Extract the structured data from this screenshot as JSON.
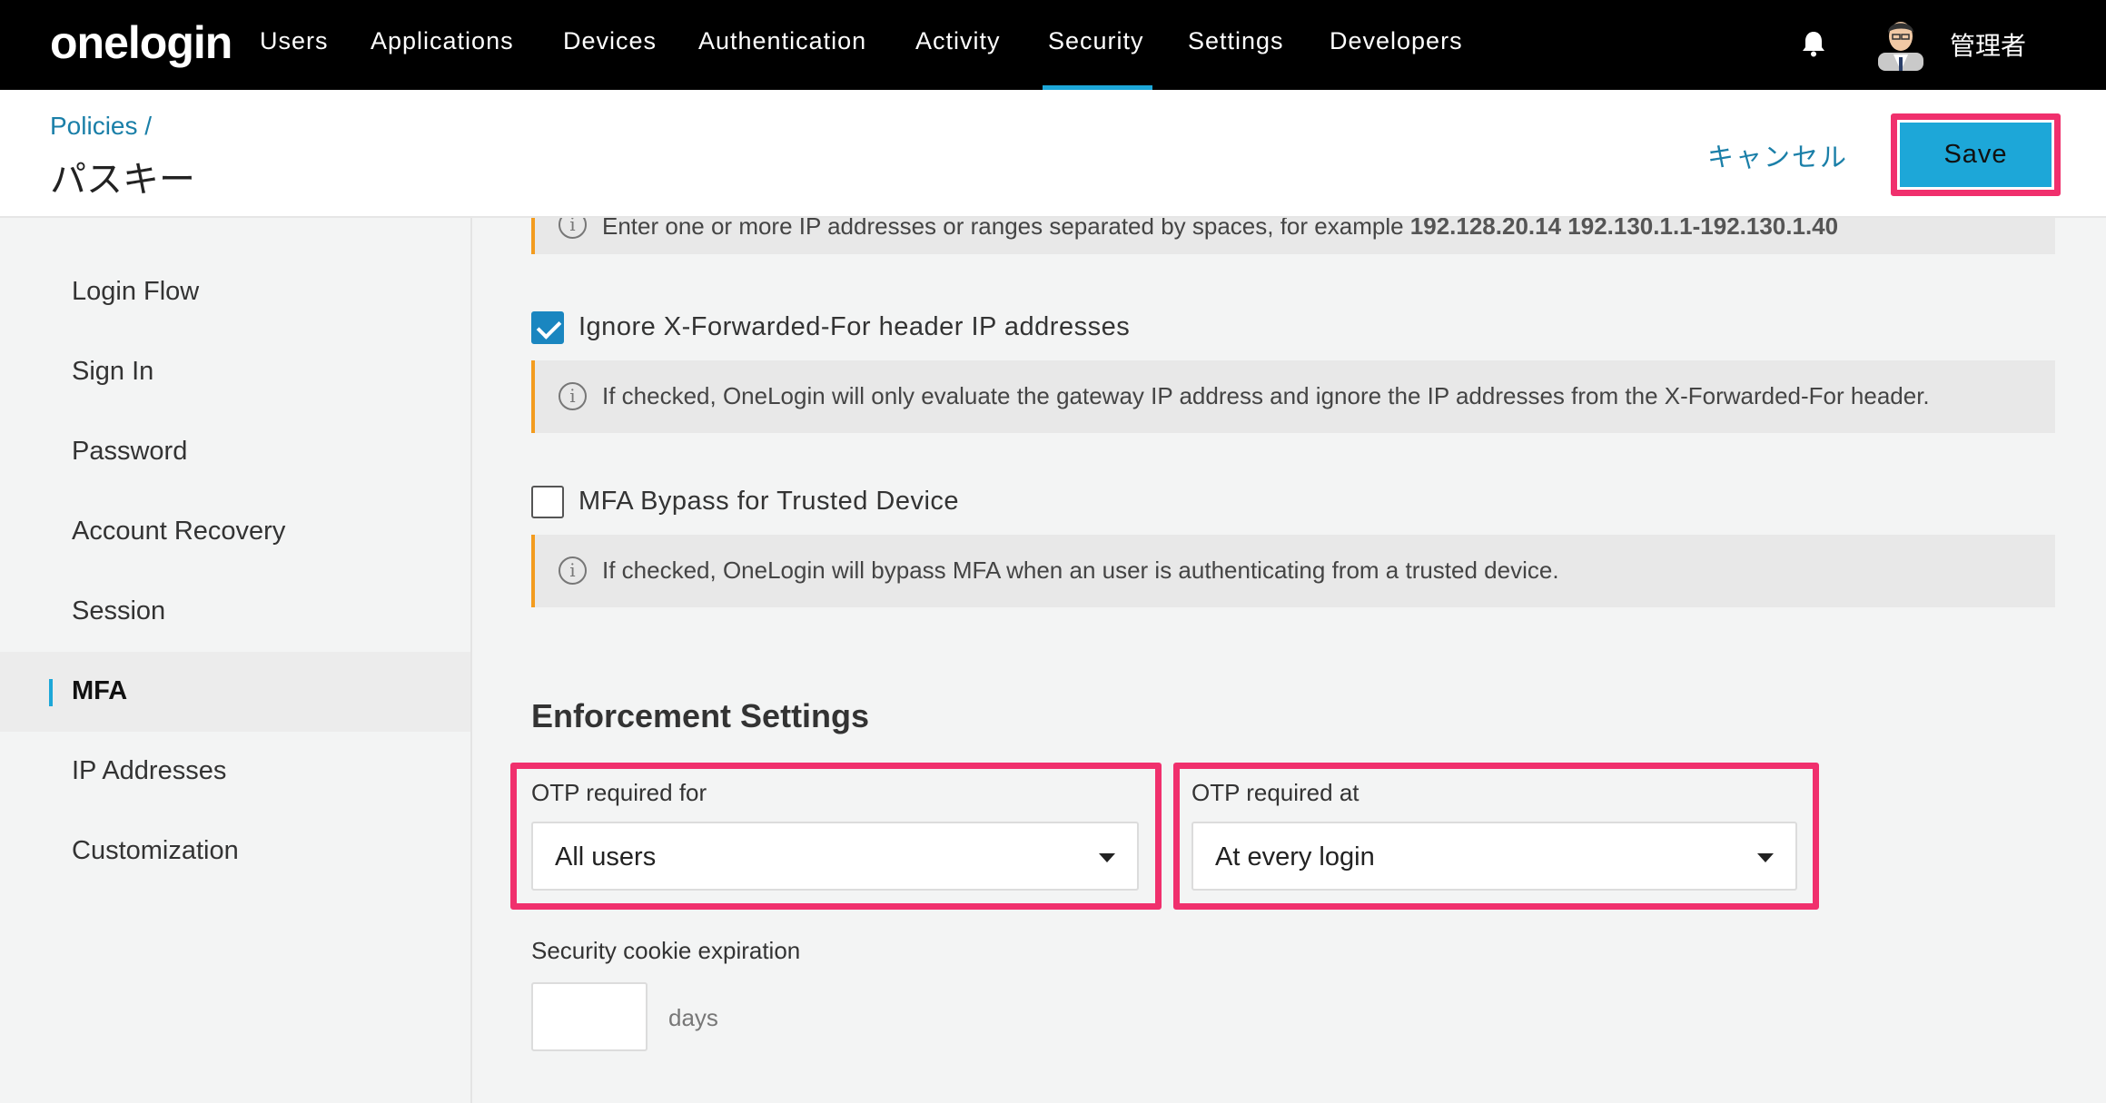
{
  "nav": {
    "logo": "onelogin",
    "items": [
      "Users",
      "Applications",
      "Devices",
      "Authentication",
      "Activity",
      "Security",
      "Settings",
      "Developers"
    ],
    "active": "Security",
    "user": "管理者"
  },
  "header": {
    "breadcrumb": "Policies /",
    "title": "パスキー",
    "cancel_label": "キャンセル",
    "save_label": "Save"
  },
  "sidebar": {
    "items": [
      {
        "label": "Login Flow"
      },
      {
        "label": "Sign In"
      },
      {
        "label": "Password"
      },
      {
        "label": "Account Recovery"
      },
      {
        "label": "Session"
      },
      {
        "label": "MFA"
      },
      {
        "label": "IP Addresses"
      },
      {
        "label": "Customization"
      }
    ],
    "active": "MFA"
  },
  "main": {
    "top_info": {
      "text": "Enter one or more IP addresses or ranges separated by spaces, for example ",
      "example": "192.128.20.14 192.130.1.1-192.130.1.40"
    },
    "ignore_xff": {
      "label": "Ignore X-Forwarded-For header IP addresses",
      "checked": true,
      "info": "If checked, OneLogin will only evaluate the gateway IP address and ignore the IP addresses from the X-Forwarded-For header."
    },
    "mfa_bypass": {
      "label": "MFA Bypass for Trusted Device",
      "checked": false,
      "info": "If checked, OneLogin will bypass MFA when an user is authenticating from a trusted device."
    },
    "enforcement": {
      "title": "Enforcement Settings",
      "otp_for_label": "OTP required for",
      "otp_for_value": "All users",
      "otp_at_label": "OTP required at",
      "otp_at_value": "At every login"
    },
    "cookie": {
      "label": "Security cookie expiration",
      "value": "",
      "unit": "days"
    }
  },
  "colors": {
    "accent": "#1da7d8",
    "highlight": "#f0306d",
    "info_border": "#f39c1f"
  }
}
